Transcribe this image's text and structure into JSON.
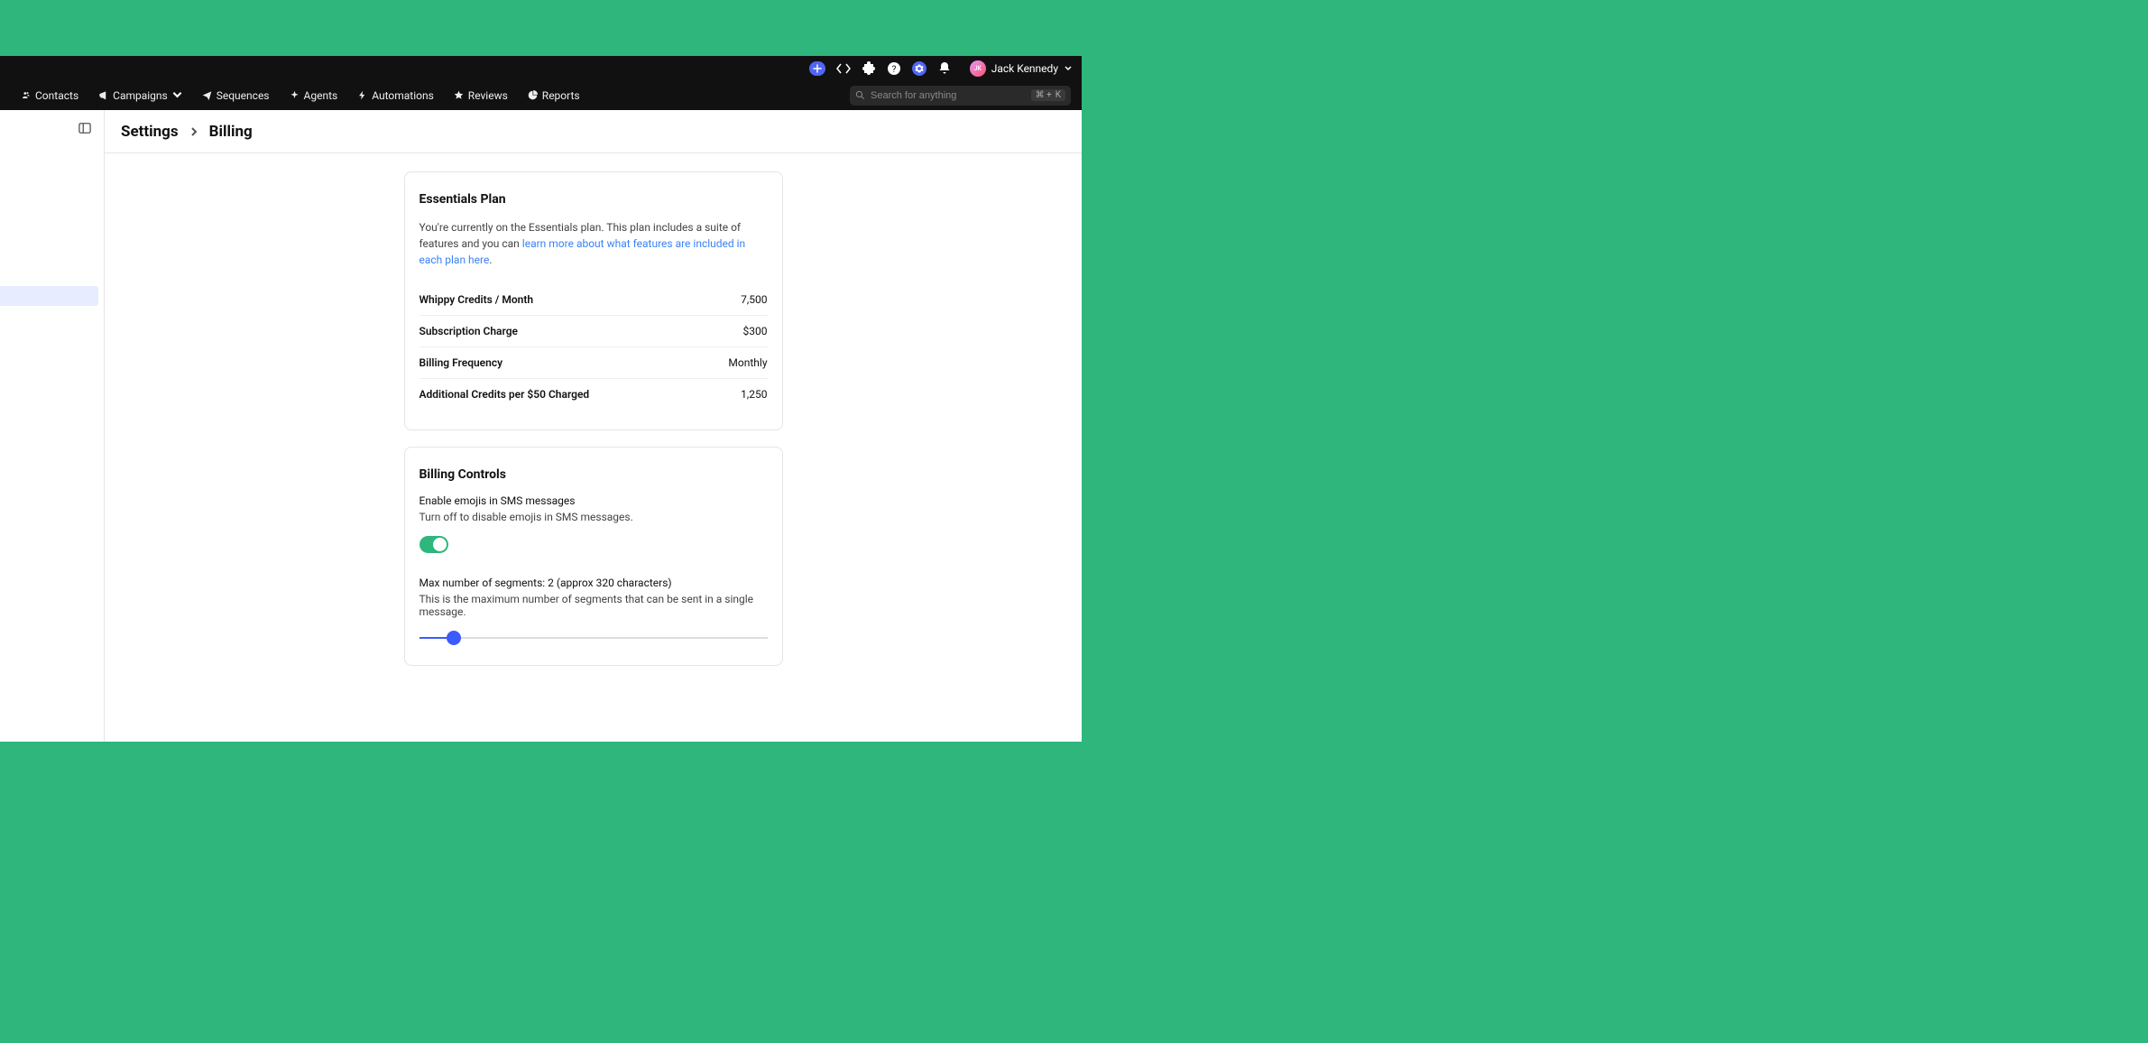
{
  "topbar": {
    "avatar_initials": "JK",
    "user_name": "Jack Kennedy"
  },
  "nav": {
    "items": [
      {
        "icon": "contacts",
        "label": "Contacts"
      },
      {
        "icon": "campaigns",
        "label": "Campaigns"
      },
      {
        "icon": "sequences",
        "label": "Sequences"
      },
      {
        "icon": "agents",
        "label": "Agents"
      },
      {
        "icon": "automations",
        "label": "Automations"
      },
      {
        "icon": "reviews",
        "label": "Reviews"
      },
      {
        "icon": "reports",
        "label": "Reports"
      }
    ],
    "search_placeholder": "Search for anything",
    "shortcut_mod": "⌘ +",
    "shortcut_key": "K"
  },
  "breadcrumb": {
    "parent": "Settings",
    "current": "Billing"
  },
  "plan_card": {
    "title": "Essentials Plan",
    "desc_prefix": "You're currently on the Essentials plan. This plan includes a suite of features and you can ",
    "desc_link": "learn more about what features are included in each plan here",
    "desc_suffix": ".",
    "rows": [
      {
        "label": "Whippy Credits / Month",
        "value": "7,500"
      },
      {
        "label": "Subscription Charge",
        "value": "$300"
      },
      {
        "label": "Billing Frequency",
        "value": "Monthly"
      },
      {
        "label": "Additional Credits per $50 Charged",
        "value": "1,250"
      }
    ]
  },
  "controls_card": {
    "title": "Billing Controls",
    "emoji": {
      "title": "Enable emojis in SMS messages",
      "desc": "Turn off to disable emojis in SMS messages.",
      "enabled": true
    },
    "segments": {
      "title": "Max number of segments: 2 (approx 320 characters)",
      "desc": "This is the maximum number of segments that can be sent in a single message."
    }
  }
}
